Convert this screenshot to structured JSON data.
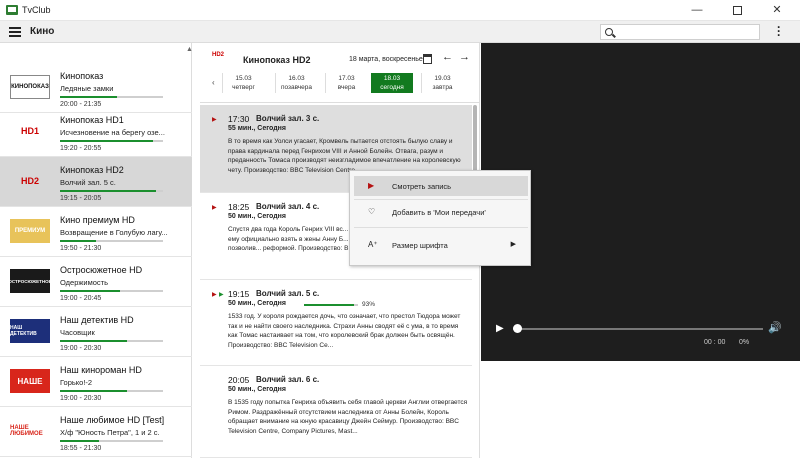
{
  "window": {
    "title": "TvClub"
  },
  "appbar": {
    "section": "Кино"
  },
  "colors": {
    "accent": "#127a1f",
    "record": "#b51212",
    "player_bg": "#1e1e1e"
  },
  "channels": [
    {
      "name": "Кинопоказ",
      "program": "Ледяные замки",
      "time": "20:00 - 21:35",
      "progress": 0.55,
      "logo": "КИНОПОКАЗ"
    },
    {
      "name": "Кинопоказ HD1",
      "program": "Исчезновение на берегу озе...",
      "time": "19:20 - 20:55",
      "progress": 0.9,
      "logo": "HD1"
    },
    {
      "name": "Кинопоказ HD2",
      "program": "Волчий зал. 5 с.",
      "time": "19:15 - 20:05",
      "progress": 0.93,
      "logo": "HD2"
    },
    {
      "name": "Кино премиум HD",
      "program": "Возвращение в Голубую лагу...",
      "time": "19:50 - 21:30",
      "progress": 0.35,
      "logo": "ПРЕМИУМ"
    },
    {
      "name": "Остросюжетное HD",
      "program": "Одержимость",
      "time": "19:00 - 20:45",
      "progress": 0.58,
      "logo": "ОСТРОСЮЖЕТНОЕ"
    },
    {
      "name": "Наш детектив HD",
      "program": "Часовщик",
      "time": "19:00 - 20:30",
      "progress": 0.65,
      "logo": "НАШ ДЕТЕКТИВ"
    },
    {
      "name": "Наш кинороман HD",
      "program": "Горько!-2",
      "time": "19:00 - 20:30",
      "progress": 0.65,
      "logo": "НАШЕ"
    },
    {
      "name": "Наше любимое HD [Test]",
      "program": "Х/ф \"Юность Петра\", 1 и 2 с.",
      "time": "18:55 - 21:30",
      "progress": 0.38,
      "logo": "НАШЕ ЛЮБИМОЕ"
    }
  ],
  "schedule": {
    "logo": "HD2",
    "channel": "Кинопоказ HD2",
    "date": "18 марта, воскресенье",
    "days": [
      {
        "date": "15.03",
        "label": "четверг"
      },
      {
        "date": "16.03",
        "label": "позавчера"
      },
      {
        "date": "17.03",
        "label": "вчера"
      },
      {
        "date": "18.03",
        "label": "сегодня"
      },
      {
        "date": "19.03",
        "label": "завтра"
      }
    ],
    "programs": [
      {
        "time": "17:30",
        "title": "Волчий зал. 3 с.",
        "meta": "55 мин., Сегодня",
        "desc": "В то время как Уолси угасает, Кромвель пытается отстоять былую славу и права кардинала перед Генрихом VIII и Анной Болейн. Отвага, разум и преданность Томаса производят неизгладимое впечатление на королевскую чету. Производство: BBC Television Centre"
      },
      {
        "time": "18:25",
        "title": "Волчий зал. 4 с.",
        "meta": "50 мин., Сегодня",
        "desc": "Спустя два года Король Генрих VIII вс... провозглашающий его главой англии... ему официально взять в жены Анну Б... помешать раскол общества, позволив... реформой. Производство: BBC Televi..."
      },
      {
        "time": "19:15",
        "title": "Волчий зал. 5 с.",
        "meta": "50 мин., Сегодня",
        "progress": 0.93,
        "pct": "93%",
        "desc": "1533 год. У короля рождается дочь, что означает, что престол Тюдора может так и не найти своего наследника. Страхи Анны сводят её с ума, в то время как Томас настаивает на том, что королевский брак должен быть освящён. Производство: BBC Television Ce..."
      },
      {
        "time": "20:05",
        "title": "Волчий зал. 6 с.",
        "meta": "50 мин., Сегодня",
        "desc": "В 1535 году попытка Генриха объявить себя главой церкви Англии отвергается Римом. Раздражённый отсутствием наследника от Анны Болейн, Король обращает внимание на юную красавицу Джейн Сеймур. Производство: BBC Television Centre, Company Pictures, Mast..."
      }
    ]
  },
  "player": {
    "time": "00 : 00",
    "percent": "0%",
    "progress": 0
  },
  "context_menu": {
    "items": [
      {
        "label": "Смотреть запись",
        "icon": "play-icon"
      },
      {
        "label": "Добавить в 'Мои передачи'",
        "icon": "heart-icon"
      },
      {
        "label": "Размер шрифта",
        "icon": "font-size-icon"
      }
    ]
  }
}
